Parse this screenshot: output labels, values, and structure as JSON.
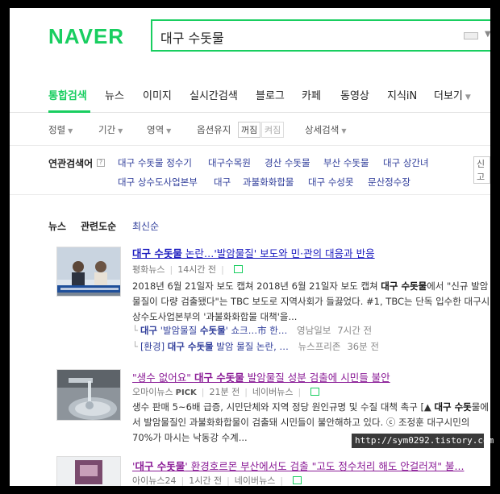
{
  "logo": "NAVER",
  "search": {
    "query": "대구 수돗물"
  },
  "tabs": [
    "통합검색",
    "뉴스",
    "이미지",
    "실시간검색",
    "블로그",
    "카페",
    "동영상",
    "지식iN",
    "더보기"
  ],
  "options": {
    "sort": "정렬",
    "period": "기간",
    "area": "영역",
    "keep": "옵션유지",
    "keep_on": "꺼짐",
    "keep_off": "켜짐",
    "detail": "상세검색"
  },
  "related": {
    "title": "연관검색어",
    "help": "?",
    "side": "신고",
    "items": [
      "대구 수돗물 정수기",
      "대구수목원",
      "경산 수돗물",
      "부산 수돗물",
      "대구 상간녀",
      "대구 상수도사업본부",
      "대구",
      "과불화화합물",
      "대구 수성못",
      "문산정수장"
    ]
  },
  "news_header": {
    "label": "뉴스",
    "relevance": "관련도순",
    "latest": "최신순"
  },
  "articles": [
    {
      "title_pre": "",
      "title_bold": "대구 수돗물",
      "title_post": " 논란…'발암물질' 보도와 민·관의 대응과 반응",
      "press": "평화뉴스",
      "time": "14시간 전",
      "desc_1": "2018년 6월 21일자 보도 캡쳐 2018년 6월 21일자 보도 캡쳐",
      "desc_bold": "대구 수돗물",
      "desc_2": "에서 \"신규 발암물질이 다량 검출됐다\"는 TBC 보도로 지역사회가 들끓었다. #1, TBC는 단독 입수한 대구시 상수도사업본부의 '과불화화합물 대책'을...",
      "subs": [
        {
          "pre": "",
          "bold1": "대구",
          "mid": " '발암물질 ",
          "bold2": "수돗물",
          "post": "' 쇼크…市 한…",
          "press": "영남일보",
          "time": "7시간 전"
        },
        {
          "pre": "[환경] ",
          "bold1": "대구 수돗물",
          "mid": " 발암 물질 논란, …",
          "bold2": "",
          "post": "",
          "press": "뉴스프리존",
          "time": "36분 전"
        }
      ]
    },
    {
      "title_pre": "\"생수 없어요\" ",
      "title_bold": "대구 수돗물",
      "title_post": " 발암물질 성분 검출에 시민들 불안",
      "press": "오마이뉴스",
      "pick": "PICK",
      "time": "21분 전",
      "naver": "네이버뉴스",
      "desc_1": "생수 판매 5~6배 급증, 시민단체와 지역 정당 원인규명 및 수질 대책 촉구 [▲",
      "desc_bold": "대구 수돗",
      "desc_2": "물에서 발암물질인 과불화화합물이 검출돼 시민들이 불안해하고 있다. ⓒ 조정훈 대구시민의 70%가 마시는 낙동강 수계..."
    },
    {
      "title_pre": "'",
      "title_bold": "대구 수돗물",
      "title_post": "' 환경호르몬 부산에서도 검출 \"고도 정수처리 해도 안걸러져\" 불...",
      "press": "아이뉴스24",
      "time": "1시간 전",
      "naver": "네이버뉴스"
    }
  ],
  "watermark": "http://sym0292.tistory.com"
}
